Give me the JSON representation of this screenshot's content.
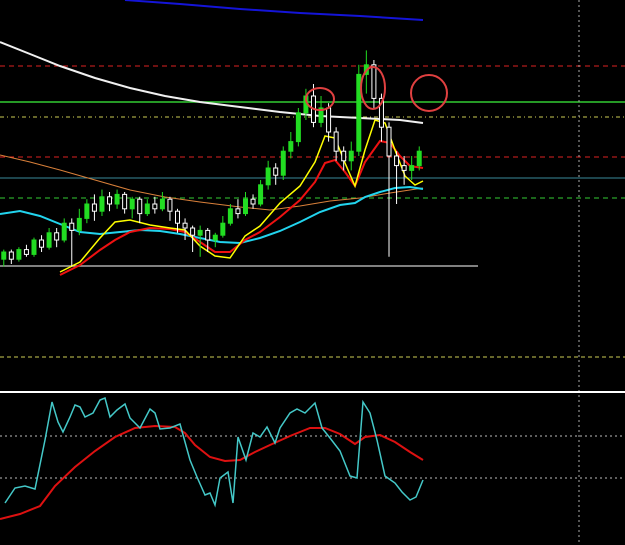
{
  "colors": {
    "background": "#000000",
    "bull": "#22dd22",
    "bear": "#ffffff",
    "ema_fast": "#ffff00",
    "ema_mid": "#ee1111",
    "ema_slow": "#22d4ee",
    "ma_orange": "#d9803a",
    "ma_white": "#f0f0f0",
    "ma_blue": "#1414d8",
    "level_red": "#dd2222",
    "level_green": "#33cc33",
    "level_cyan": "#3a8a9a",
    "level_gray": "#aaaaaa",
    "osc_k": "#44c8c8",
    "osc_d": "#dd1111",
    "annotation": "#e04040",
    "separator": "#ffffff",
    "grid": "#bbbbbb"
  },
  "chart_data": {
    "type": "candlestick",
    "grid": true,
    "x_range": [
      0,
      56
    ],
    "y_range": [
      0,
      100
    ],
    "candles": [
      [
        0.5,
        17.0,
        20.0,
        14.0,
        21.0
      ],
      [
        1.5,
        20.0,
        17.0,
        15.0,
        21.0
      ],
      [
        2.5,
        17.0,
        21.0,
        16.0,
        22.0
      ],
      [
        3.5,
        21.0,
        19.0,
        18.0,
        23.0
      ],
      [
        4.5,
        19.0,
        25.0,
        18.0,
        26.0
      ],
      [
        5.5,
        25.0,
        22.0,
        20.0,
        27.0
      ],
      [
        6.5,
        22.0,
        28.0,
        21.0,
        30.0
      ],
      [
        7.5,
        28.0,
        25.0,
        22.0,
        30.0
      ],
      [
        8.5,
        25.0,
        32.0,
        24.0,
        34.0
      ],
      [
        9.5,
        32.0,
        29.0,
        14.0,
        34.0
      ],
      [
        10.5,
        29.0,
        34.0,
        27.0,
        38.0
      ],
      [
        11.5,
        34.0,
        40.0,
        32.0,
        42.0
      ],
      [
        12.5,
        40.0,
        37.0,
        33.0,
        44.0
      ],
      [
        13.5,
        37.0,
        43.0,
        35.0,
        46.0
      ],
      [
        14.5,
        43.0,
        40.0,
        37.0,
        45.0
      ],
      [
        15.5,
        40.0,
        44.0,
        38.0,
        46.0
      ],
      [
        16.5,
        44.0,
        38.0,
        36.0,
        45.0
      ],
      [
        17.5,
        38.0,
        42.0,
        34.0,
        43.0
      ],
      [
        18.5,
        42.0,
        36.0,
        32.0,
        43.0
      ],
      [
        19.5,
        36.0,
        40.0,
        35.0,
        42.0
      ],
      [
        20.5,
        40.0,
        38.0,
        36.0,
        43.0
      ],
      [
        21.5,
        38.0,
        42.0,
        37.0,
        45.0
      ],
      [
        22.5,
        42.0,
        37.0,
        33.0,
        43.0
      ],
      [
        23.5,
        37.0,
        32.0,
        28.0,
        38.0
      ],
      [
        24.5,
        32.0,
        30.0,
        25.0,
        34.0
      ],
      [
        25.5,
        30.0,
        27.0,
        20.0,
        31.0
      ],
      [
        26.5,
        27.0,
        29.0,
        18.0,
        31.0
      ],
      [
        27.5,
        29.0,
        25.0,
        20.0,
        30.0
      ],
      [
        28.5,
        25.0,
        27.0,
        22.0,
        28.0
      ],
      [
        29.5,
        27.0,
        32.0,
        26.0,
        35.0
      ],
      [
        30.5,
        32.0,
        38.0,
        31.0,
        40.0
      ],
      [
        31.5,
        38.0,
        36.0,
        34.0,
        42.0
      ],
      [
        32.5,
        36.0,
        42.0,
        35.0,
        45.0
      ],
      [
        33.5,
        42.0,
        40.0,
        38.0,
        44.0
      ],
      [
        34.5,
        40.0,
        48.0,
        39.0,
        50.0
      ],
      [
        35.5,
        48.0,
        55.0,
        46.0,
        58.0
      ],
      [
        36.5,
        55.0,
        52.0,
        48.0,
        57.0
      ],
      [
        37.5,
        52.0,
        62.0,
        50.0,
        64.0
      ],
      [
        38.5,
        62.0,
        66.0,
        59.0,
        70.0
      ],
      [
        39.5,
        66.0,
        78.0,
        64.0,
        80.0
      ],
      [
        40.5,
        78.0,
        85.0,
        75.0,
        88.0
      ],
      [
        41.5,
        85.0,
        74.0,
        72.0,
        90.0
      ],
      [
        42.5,
        74.0,
        80.0,
        72.0,
        85.0
      ],
      [
        43.5,
        80.0,
        70.0,
        66.0,
        82.0
      ],
      [
        44.5,
        70.0,
        62.0,
        58.0,
        72.0
      ],
      [
        45.5,
        62.0,
        58.0,
        54.0,
        64.0
      ],
      [
        46.5,
        58.0,
        62.0,
        54.0,
        66.0
      ],
      [
        47.5,
        62.0,
        94.0,
        60.0,
        98.0
      ],
      [
        48.5,
        94.0,
        98.0,
        86.0,
        104.0
      ],
      [
        49.5,
        98.0,
        84.0,
        80.0,
        100.0
      ],
      [
        50.5,
        84.0,
        72.0,
        66.0,
        86.0
      ],
      [
        51.5,
        72.0,
        60.0,
        18.0,
        74.0
      ],
      [
        52.5,
        60.0,
        56.0,
        40.0,
        62.0
      ],
      [
        53.5,
        56.0,
        54.0,
        48.0,
        60.0
      ],
      [
        54.5,
        54.0,
        56.0,
        50.0,
        60.0
      ],
      [
        55.5,
        56.0,
        62.0,
        54.0,
        64.0
      ]
    ]
  }
}
